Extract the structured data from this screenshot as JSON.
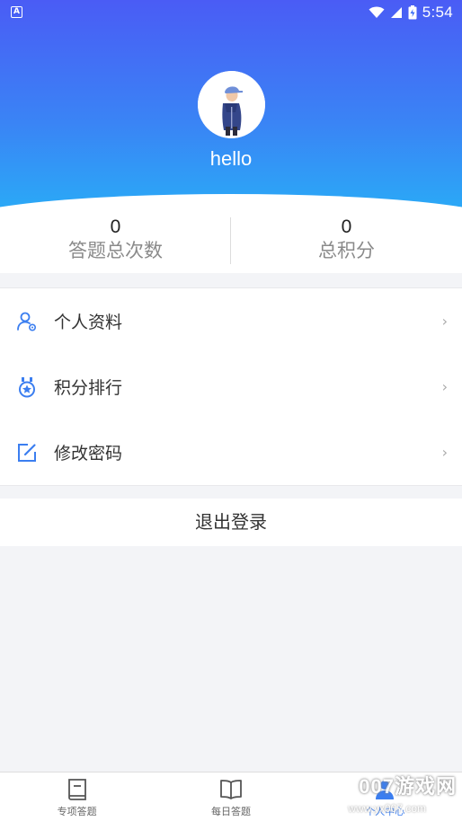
{
  "status_bar": {
    "left_icon": "A",
    "time": "5:54",
    "icons": [
      "wifi-icon",
      "signal-icon",
      "battery-charging-icon"
    ]
  },
  "profile": {
    "username": "hello",
    "avatar_icon": "user-avatar"
  },
  "stats": [
    {
      "value": "0",
      "label": "答题总次数"
    },
    {
      "value": "0",
      "label": "总积分"
    }
  ],
  "menu": [
    {
      "label": "个人资料",
      "icon": "user-settings-icon"
    },
    {
      "label": "积分排行",
      "icon": "medal-icon"
    },
    {
      "label": "修改密码",
      "icon": "edit-icon"
    }
  ],
  "logout_label": "退出登录",
  "bottom_nav": [
    {
      "label": "专项答题",
      "icon": "book-icon"
    },
    {
      "label": "每日答题",
      "icon": "open-book-icon"
    },
    {
      "label": "个人中心",
      "icon": "person-icon"
    }
  ],
  "watermark": {
    "text": "007游戏网",
    "sub": "www.yx007.com"
  },
  "colors": {
    "gradient_top": "#4a5cf5",
    "gradient_bottom": "#1fc4f7",
    "accent": "#3b7ef0",
    "background": "#f3f4f7"
  }
}
